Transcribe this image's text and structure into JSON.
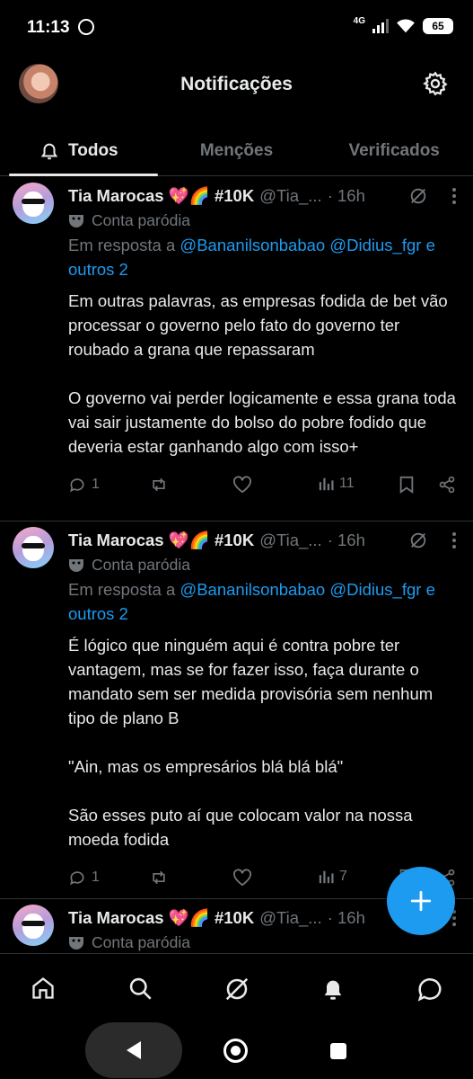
{
  "status_bar": {
    "time": "11:13",
    "network": "4G",
    "battery": "65"
  },
  "header": {
    "title": "Notificações"
  },
  "tabs": [
    {
      "label": "Todos",
      "active": true
    },
    {
      "label": "Menções",
      "active": false
    },
    {
      "label": "Verificados",
      "active": false
    }
  ],
  "posts": [
    {
      "author": "Tia Marocas 💖🌈 #10K",
      "handle": "@Tia_...",
      "time": "· 16h",
      "parody": "Conta paródia",
      "reply_prefix": "Em resposta a",
      "mention1": "@Bananilsonbabao",
      "mention2": "@Didius_fgr",
      "mention3": "e outros 2",
      "text": "Em outras palavras, as empresas fodida de bet vão processar o governo pelo fato do governo ter roubado a grana que repassaram\n\nO governo vai perder logicamente e essa grana toda vai sair justamente do bolso do pobre fodido que deveria estar ganhando algo com isso+",
      "replies": "1",
      "views": "11"
    },
    {
      "author": "Tia Marocas 💖🌈 #10K",
      "handle": "@Tia_...",
      "time": "· 16h",
      "parody": "Conta paródia",
      "reply_prefix": "Em resposta a",
      "mention1": "@Bananilsonbabao",
      "mention2": "@Didius_fgr",
      "mention3": "e outros 2",
      "text": "É lógico que ninguém aqui é contra pobre ter vantagem, mas se for fazer isso, faça durante o mandato sem ser medida provisória sem nenhum tipo de plano B\n\n\"Ain, mas os empresários blá blá blá\"\n\nSão esses puto aí que colocam valor na nossa moeda fodida",
      "replies": "1",
      "views": "7"
    },
    {
      "author": "Tia Marocas 💖🌈 #10K",
      "handle": "@Tia_...",
      "time": "· 16h",
      "parody": "Conta paródia"
    }
  ],
  "colors": {
    "accent": "#1d9bf0",
    "background": "#000000",
    "text": "#e7e9ea",
    "muted": "#71767b"
  },
  "icons": [
    "whatsapp-icon",
    "gear-icon",
    "bell-icon",
    "grok-icon",
    "more-icon",
    "parody-mask-icon",
    "reply-icon",
    "repost-icon",
    "like-icon",
    "views-icon",
    "bookmark-icon",
    "share-icon",
    "plus-icon",
    "home-icon",
    "search-icon",
    "messages-icon"
  ]
}
